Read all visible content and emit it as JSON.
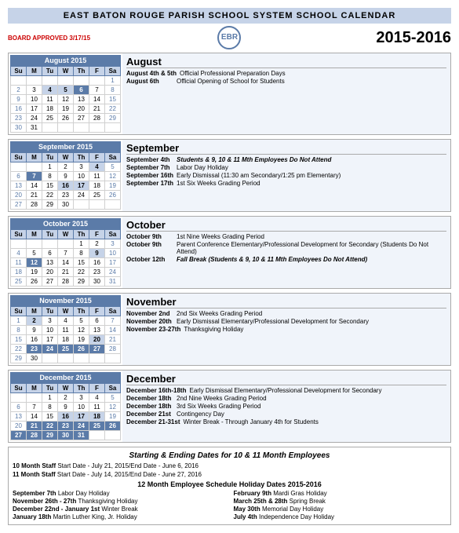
{
  "header": {
    "title": "EAST BATON ROUGE PARISH SCHOOL SYSTEM SCHOOL CALENDAR",
    "logo": "EBR",
    "year": "2015-2016",
    "board_approved": "BOARD APPROVED 3/17/15"
  },
  "months": [
    {
      "name": "August 2015",
      "short": "August",
      "days_header": [
        "Su",
        "M",
        "Tu",
        "W",
        "Th",
        "F",
        "Sa"
      ],
      "weeks": [
        [
          "",
          "",
          "",
          "",
          "",
          "",
          "1"
        ],
        [
          "2",
          "3",
          "4",
          "5",
          "6",
          "7",
          "8"
        ],
        [
          "9",
          "10",
          "11",
          "12",
          "13",
          "14",
          "15"
        ],
        [
          "16",
          "17",
          "18",
          "19",
          "20",
          "21",
          "22"
        ],
        [
          "23",
          "24",
          "25",
          "26",
          "27",
          "28",
          "29"
        ],
        [
          "30",
          "31",
          "",
          "",
          "",
          "",
          ""
        ]
      ],
      "highlight_days": [
        "4",
        "5",
        "6"
      ],
      "events": [
        {
          "date": "August 4th & 5th",
          "desc": "Official Professional Preparation Days",
          "style": "normal"
        },
        {
          "date": "August 6th",
          "desc": "Official Opening of School for Students",
          "style": "normal"
        }
      ]
    },
    {
      "name": "September 2015",
      "short": "September",
      "days_header": [
        "Su",
        "M",
        "Tu",
        "W",
        "Th",
        "F",
        "Sa"
      ],
      "weeks": [
        [
          "",
          "",
          "1",
          "2",
          "3",
          "4",
          "5"
        ],
        [
          "6",
          "7",
          "8",
          "9",
          "10",
          "11",
          "12"
        ],
        [
          "13",
          "14",
          "15",
          "16",
          "17",
          "18",
          "19"
        ],
        [
          "20",
          "21",
          "22",
          "23",
          "24",
          "25",
          "26"
        ],
        [
          "27",
          "28",
          "29",
          "30",
          "",
          "",
          ""
        ]
      ],
      "highlight_days": [
        "4",
        "7",
        "16",
        "17"
      ],
      "events": [
        {
          "date": "September 4th",
          "desc": "Students & 9, 10 & 11 Mth Employees Do Not Attend",
          "style": "italic"
        },
        {
          "date": "September 7th",
          "desc": "Labor Day Holiday",
          "style": "normal"
        },
        {
          "date": "September 16th",
          "desc": "Early Dismissal (11:30 am Secondary/1:25 pm Elementary)",
          "style": "normal"
        },
        {
          "date": "September 17th",
          "desc": "1st Six Weeks Grading Period",
          "style": "normal"
        }
      ]
    },
    {
      "name": "October 2015",
      "short": "October",
      "days_header": [
        "Su",
        "M",
        "Tu",
        "W",
        "Th",
        "F",
        "Sa"
      ],
      "weeks": [
        [
          "",
          "",
          "",
          "",
          "1",
          "2",
          "3"
        ],
        [
          "4",
          "5",
          "6",
          "7",
          "8",
          "9",
          "10"
        ],
        [
          "11",
          "12",
          "13",
          "14",
          "15",
          "16",
          "17"
        ],
        [
          "18",
          "19",
          "20",
          "21",
          "22",
          "23",
          "24"
        ],
        [
          "25",
          "26",
          "27",
          "28",
          "29",
          "30",
          "31"
        ]
      ],
      "highlight_days": [
        "9",
        "12"
      ],
      "events": [
        {
          "date": "October 9th",
          "desc": "1st Nine Weeks Grading Period",
          "style": "normal"
        },
        {
          "date": "October 9th",
          "desc": "Parent Conference Elementary/Professional Development for Secondary (Students Do Not Attend)",
          "style": "normal"
        },
        {
          "date": "October 12th",
          "desc": "Fall Break (Students & 9, 10 & 11 Mth Employees Do Not Attend)",
          "style": "italic"
        }
      ]
    },
    {
      "name": "November 2015",
      "short": "November",
      "days_header": [
        "Su",
        "M",
        "Tu",
        "W",
        "Th",
        "F",
        "Sa"
      ],
      "weeks": [
        [
          "1",
          "2",
          "3",
          "4",
          "5",
          "6",
          "7"
        ],
        [
          "8",
          "9",
          "10",
          "11",
          "12",
          "13",
          "14"
        ],
        [
          "15",
          "16",
          "17",
          "18",
          "19",
          "20",
          "21"
        ],
        [
          "22",
          "23",
          "24",
          "25",
          "26",
          "27",
          "28"
        ],
        [
          "29",
          "30",
          "",
          "",
          "",
          "",
          ""
        ]
      ],
      "highlight_days": [
        "2",
        "20",
        "23",
        "24",
        "25",
        "26",
        "27"
      ],
      "events": [
        {
          "date": "November 2nd",
          "desc": "2nd Six Weeks Grading Period",
          "style": "normal"
        },
        {
          "date": "November 20th",
          "desc": "Early Dismissal Elementary/Professional Development for Secondary",
          "style": "normal"
        },
        {
          "date": "November 23-27th",
          "desc": "Thanksgiving Holiday",
          "style": "normal"
        }
      ]
    },
    {
      "name": "December 2015",
      "short": "December",
      "days_header": [
        "Su",
        "M",
        "Tu",
        "W",
        "Th",
        "F",
        "Sa"
      ],
      "weeks": [
        [
          "",
          "",
          "1",
          "2",
          "3",
          "4",
          "5"
        ],
        [
          "6",
          "7",
          "8",
          "9",
          "10",
          "11",
          "12"
        ],
        [
          "13",
          "14",
          "15",
          "16",
          "17",
          "18",
          "19"
        ],
        [
          "20",
          "21",
          "22",
          "23",
          "24",
          "25",
          "26"
        ],
        [
          "27",
          "28",
          "29",
          "30",
          "31",
          "",
          ""
        ]
      ],
      "highlight_days": [
        "16",
        "17",
        "18",
        "18b",
        "21",
        "21b",
        "31"
      ],
      "events": [
        {
          "date": "December 16th-18th",
          "desc": "Early Dismissal Elementary/Professional Development for Secondary",
          "style": "normal"
        },
        {
          "date": "December 18th",
          "desc": "2nd Nine Weeks Grading Period",
          "style": "normal"
        },
        {
          "date": "December 18th",
          "desc": "3rd Six Weeks Grading Period",
          "style": "normal"
        },
        {
          "date": "December 21st",
          "desc": "Contingency Day",
          "style": "normal"
        },
        {
          "date": "December 21-31st",
          "desc": "Winter Break - Through January 4th for Students",
          "style": "normal"
        }
      ]
    }
  ],
  "footer": {
    "title": "Starting & Ending Dates for 10 & 11 Month Employees",
    "staff": [
      {
        "label": "10 Month Staff",
        "desc": "Start Date - July 21, 2015/End Date - June 6, 2016"
      },
      {
        "label": "11 Month Staff",
        "desc": "Start Date - July 14, 2015/End Date - June 27, 2016"
      }
    ],
    "holidays_title": "12 Month Employee Schedule Holiday Dates 2015-2016",
    "holidays": [
      {
        "date": "September 7th",
        "name": "Labor Day Holiday"
      },
      {
        "date": "February 9th",
        "name": "Mardi Gras Holiday"
      },
      {
        "date": "November 26th - 27th",
        "name": "Thanksgiving Holiday"
      },
      {
        "date": "March 25th & 28th",
        "name": "Spring Break"
      },
      {
        "date": "December 22nd - January 1st",
        "name": "Winter Break"
      },
      {
        "date": "May 30th",
        "name": "Memorial Day Holiday"
      },
      {
        "date": "January 18th",
        "name": "Martin Luther King, Jr. Holiday"
      },
      {
        "date": "July 4th",
        "name": "Independence Day Holiday"
      }
    ]
  }
}
